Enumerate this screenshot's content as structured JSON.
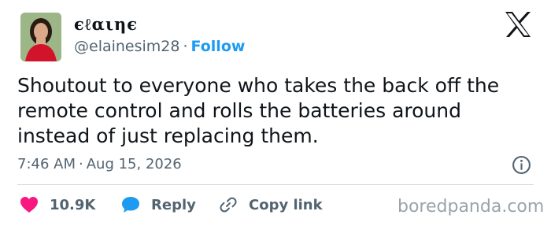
{
  "tweet": {
    "author": {
      "display_name": "ϵℓαιηϵ",
      "handle": "@elainesim28",
      "separator": "·",
      "follow_label": "Follow"
    },
    "text_lines": [
      "Shoutout to everyone who takes the back off the",
      "remote control and rolls the batteries around",
      "instead of just replacing them."
    ],
    "time": "7:46 AM",
    "date": "Aug 15, 2026",
    "actions": {
      "like_count": "10.9K",
      "reply_label": "Reply",
      "copy_label": "Copy link"
    }
  },
  "icons": {
    "platform_logo": "x-logo-icon",
    "info": "info-icon",
    "like": "heart-icon",
    "reply": "reply-bubble-icon",
    "copy": "link-icon"
  },
  "colors": {
    "like_heart": "#f91880",
    "reply_bubble": "#1d9bf0",
    "follow_link": "#1d9bf0",
    "muted_text": "#536471"
  },
  "watermark": "boredpanda.com"
}
